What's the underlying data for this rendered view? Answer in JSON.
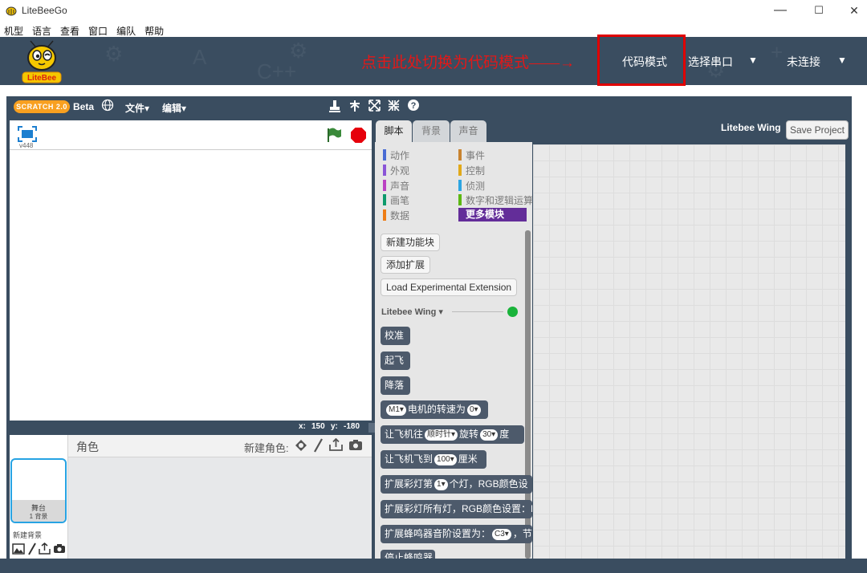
{
  "window": {
    "title": "LiteBeeGo",
    "minimize": "—",
    "maximize": "☐",
    "close": "✕"
  },
  "menubar": [
    "机型",
    "语言",
    "查看",
    "窗口",
    "编队",
    "帮助"
  ],
  "header": {
    "logo_text": "LiteBee",
    "annotation": "点击此处切换为代码模式——→",
    "code_mode": "代码模式",
    "select_port": "选择串口",
    "connection": "未连接"
  },
  "toolbar": {
    "scratch_logo": "SCRATCH 2.0",
    "beta": "Beta",
    "file_menu": "文件▾",
    "edit_menu": "编辑▾"
  },
  "stage": {
    "version": "v448",
    "x_label": "x:",
    "x_value": "150",
    "y_label": "y:",
    "y_value": "-180"
  },
  "sprites": {
    "title": "角色",
    "new_sprite": "新建角色:",
    "stage_label": "舞台",
    "stage_backdrops": "1 背景",
    "new_backdrop": "新建背景"
  },
  "tabs": {
    "scripts": "脚本",
    "backdrops": "背景",
    "sounds": "声音"
  },
  "categories_left": [
    {
      "label": "动作",
      "color": "#4a6cd4"
    },
    {
      "label": "外观",
      "color": "#8a55d7"
    },
    {
      "label": "声音",
      "color": "#bb42c3"
    },
    {
      "label": "画笔",
      "color": "#0e9a6c"
    },
    {
      "label": "数据",
      "color": "#ee7d16"
    }
  ],
  "categories_right": [
    {
      "label": "事件",
      "color": "#c88330"
    },
    {
      "label": "控制",
      "color": "#e1a91a"
    },
    {
      "label": "侦测",
      "color": "#2ca5e2"
    },
    {
      "label": "数字和逻辑运算",
      "color": "#5cb712"
    }
  ],
  "more_blocks": "更多模块",
  "palette_buttons": {
    "make_block": "新建功能块",
    "add_extension": "添加扩展",
    "load_experimental": "Load Experimental Extension"
  },
  "extension": {
    "name": "Litebee Wing ▾",
    "status_color": "#19b33a"
  },
  "blocks": {
    "calibrate": "校准",
    "takeoff": "起飞",
    "land": "降落",
    "motor_dropdown": "M1▾",
    "motor_text": "电机的转速为",
    "motor_value": "0▾",
    "rotate_pre": "让飞机往",
    "rotate_dir": "顺时针▾",
    "rotate_mid": "旋转",
    "rotate_value": "30▾",
    "rotate_unit": "度",
    "fly_pre": "让飞机飞到",
    "fly_value": "100▾",
    "fly_unit": "厘米",
    "led_pre": "扩展彩灯第",
    "led_value": "1▾",
    "led_post": "个灯，RGB颜色设",
    "led_all": "扩展彩灯所有灯，RGB颜色设置：R",
    "buzzer_pre": "扩展蜂鸣器音阶设置为：",
    "buzzer_value": "C3▾",
    "buzzer_post": "，节",
    "buzzer_stop": "停止蜂鸣器"
  },
  "script_area": {
    "sprite_name": "Litebee Wing",
    "save": "Save Project"
  }
}
